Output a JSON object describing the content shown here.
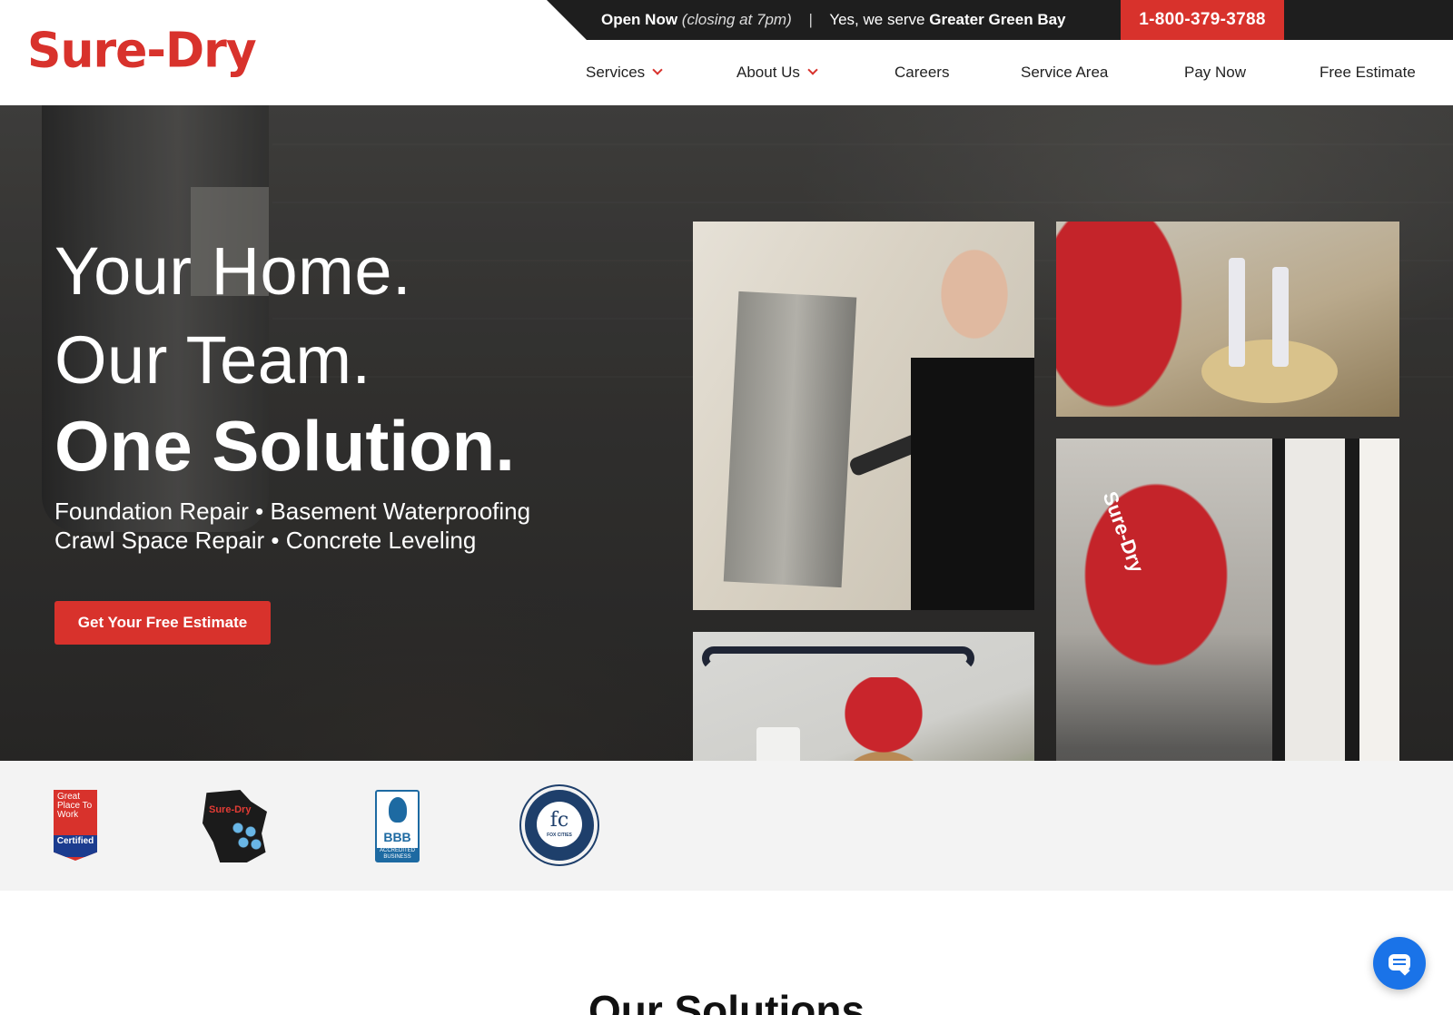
{
  "brand": {
    "logo_text": "Sure-Dry",
    "accent_color": "#d8322c"
  },
  "topbar": {
    "status": "Open Now",
    "hours_note": "(closing at 7pm)",
    "separator": "|",
    "serve_prefix": "Yes, we serve",
    "serve_area": "Greater Green Bay",
    "phone": "1-800-379-3788"
  },
  "nav": {
    "items": [
      {
        "label": "Services",
        "dropdown": true
      },
      {
        "label": "About Us",
        "dropdown": true
      },
      {
        "label": "Careers"
      },
      {
        "label": "Service Area"
      },
      {
        "label": "Pay Now"
      },
      {
        "label": "Free Estimate"
      }
    ]
  },
  "hero": {
    "line1": "Your Home.",
    "line2": "Our Team.",
    "line3": "One Solution.",
    "services_line1": "Foundation Repair • Basement Waterproofing",
    "services_line2": "Crawl Space Repair • Concrete Leveling",
    "cta_label": "Get Your Free Estimate",
    "photo_brand_text": "Sure-Dry"
  },
  "badges": {
    "gptw_text": "Great Place To Work",
    "gptw_certified": "Certified",
    "wi_brand": "Sure-Dry",
    "bbb_text": "BBB",
    "bbb_accredited": "ACCREDITED BUSINESS",
    "fc_text": "fc",
    "fc_sub": "FOX CITIES"
  },
  "solutions": {
    "heading": "Our Solutions"
  },
  "chat": {
    "icon": "chat-bubble-icon"
  }
}
